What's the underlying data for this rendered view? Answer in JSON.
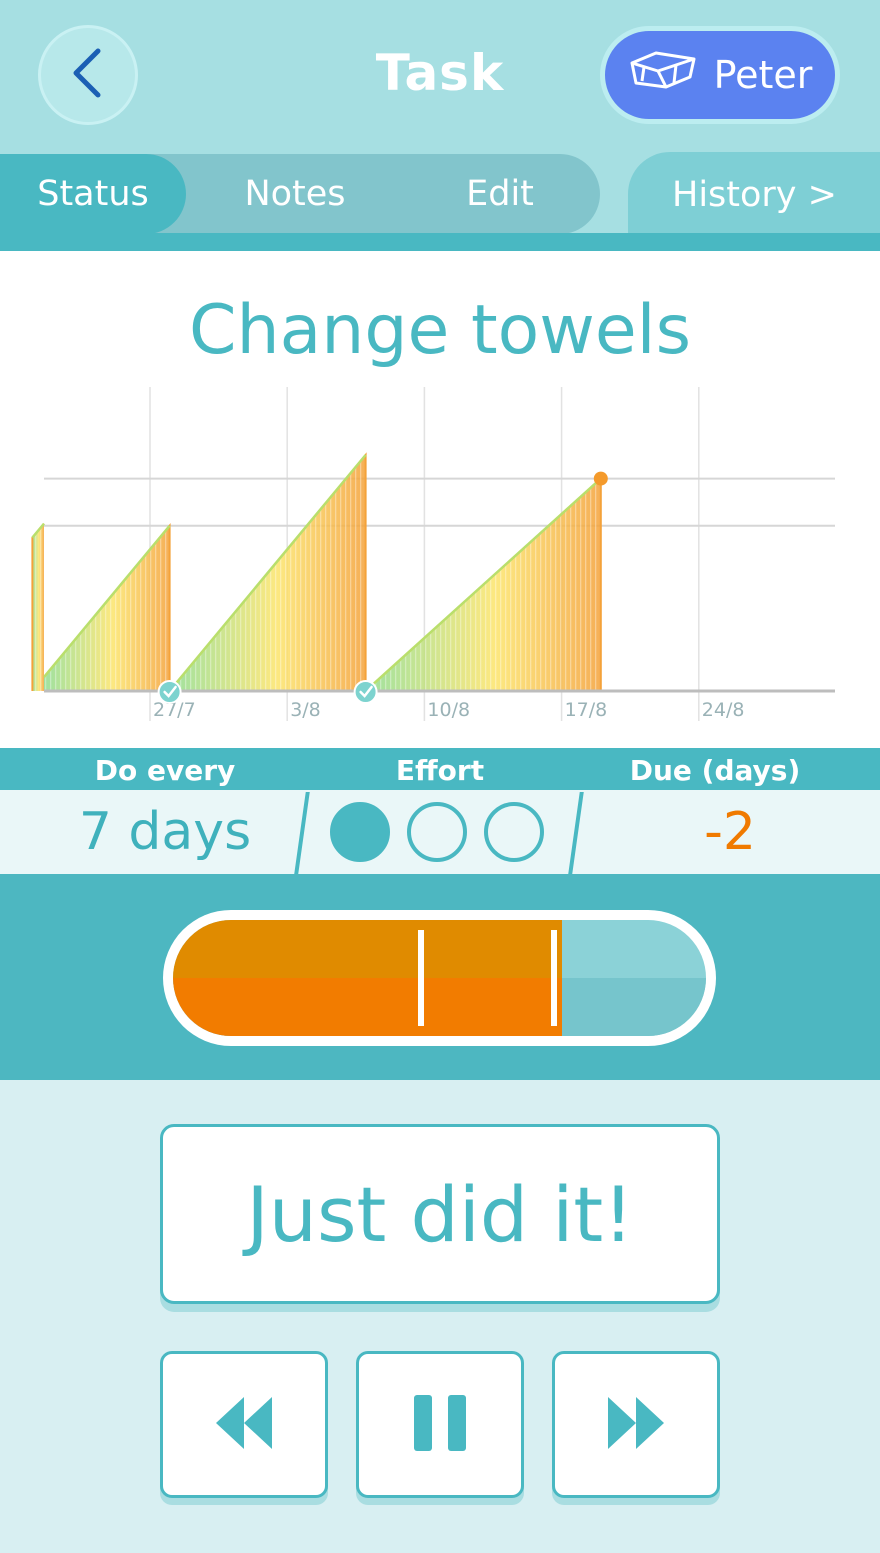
{
  "header": {
    "title": "Task",
    "user_label": "Peter",
    "user_icon": "house-icon"
  },
  "tabs": [
    {
      "label": "Status",
      "active": true
    },
    {
      "label": "Notes",
      "active": false
    },
    {
      "label": "Edit",
      "active": false
    }
  ],
  "history_tab": {
    "label": "History >"
  },
  "task": {
    "name": "Change towels"
  },
  "chart_data": {
    "type": "area",
    "x_ticks": [
      "27/7",
      "3/8",
      "10/8",
      "17/8",
      "24/8"
    ],
    "segments": [
      {
        "start": "2014-07-20",
        "end": "2014-07-21",
        "start_value": 5.5,
        "end_value": 6.5,
        "completed_at_end": true
      },
      {
        "start": "2014-07-21",
        "end": "2014-07-28",
        "start_value": 0,
        "end_value": 7,
        "completed_at_end": true
      },
      {
        "start": "2014-07-28",
        "end": "2014-08-07",
        "start_value": 0,
        "end_value": 10,
        "completed_at_end": true
      },
      {
        "start": "2014-08-07",
        "end": "2014-08-19",
        "start_value": 0,
        "end_value": 9,
        "completed_at_end": false
      }
    ],
    "gridlines_y": [
      7,
      9
    ],
    "grid": true,
    "colors": {
      "start": "#8edc8e",
      "mid": "#fce46a",
      "end": "#f4a23a",
      "point": "#f49a2b",
      "check": "#7dd3cf"
    }
  },
  "stats": {
    "do_every_label": "Do every",
    "do_every_value": "7 days",
    "effort_label": "Effort",
    "effort_level": 1,
    "effort_max": 3,
    "due_label": "Due (days)",
    "due_value": "-2"
  },
  "progress": {
    "fill_fraction": 0.73,
    "marker_fractions": [
      0.46,
      0.71
    ],
    "colors": {
      "fill_top": "#e08b00",
      "fill_bottom": "#f27c00"
    }
  },
  "actions": {
    "done_label": "Just did it!",
    "rewind_icon": "rewind-icon",
    "pause_icon": "pause-icon",
    "forward_icon": "fast-forward-icon"
  }
}
